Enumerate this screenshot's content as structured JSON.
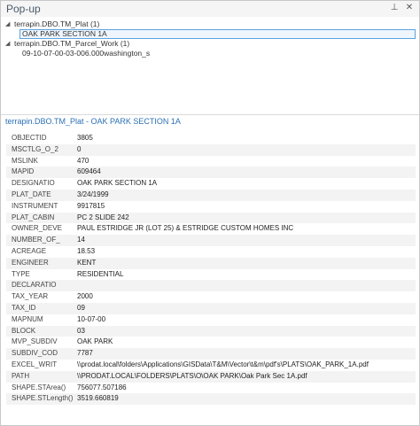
{
  "window": {
    "title": "Pop-up",
    "pin_glyph": "⊥",
    "close_glyph": "✕",
    "icons": {
      "pin": "pin-icon",
      "close": "close-icon",
      "expander": "triangle-down-icon"
    }
  },
  "tree": {
    "expander_glyph": "◢",
    "layers": [
      {
        "label": "terrapin.DBO.TM_Plat  (1)",
        "features": [
          "OAK PARK SECTION 1A"
        ]
      },
      {
        "label": "terrapin.DBO.TM_Parcel_Work  (1)",
        "features": [
          "09-10-07-00-03-006.000washington_s"
        ]
      }
    ]
  },
  "detail": {
    "title": "terrapin.DBO.TM_Plat - OAK PARK SECTION 1A",
    "fields": [
      {
        "name": "OBJECTID",
        "value": "3805"
      },
      {
        "name": "MSCTLG_O_2",
        "value": "0"
      },
      {
        "name": "MSLINK",
        "value": "470"
      },
      {
        "name": "MAPID",
        "value": "609464"
      },
      {
        "name": "DESIGNATIO",
        "value": "OAK PARK SECTION 1A"
      },
      {
        "name": "PLAT_DATE",
        "value": "3/24/1999"
      },
      {
        "name": "INSTRUMENT",
        "value": "9917815"
      },
      {
        "name": "PLAT_CABIN",
        "value": "PC 2 SLIDE 242"
      },
      {
        "name": "OWNER_DEVE",
        "value": "PAUL ESTRIDGE JR (LOT 25) & ESTRIDGE CUSTOM HOMES INC"
      },
      {
        "name": "NUMBER_OF_",
        "value": "14"
      },
      {
        "name": "ACREAGE",
        "value": "18.53"
      },
      {
        "name": "ENGINEER",
        "value": "KENT"
      },
      {
        "name": "TYPE",
        "value": "RESIDENTIAL"
      },
      {
        "name": "DECLARATIO",
        "value": ""
      },
      {
        "name": "TAX_YEAR",
        "value": "2000"
      },
      {
        "name": "TAX_ID",
        "value": "09"
      },
      {
        "name": "MAPNUM",
        "value": "10-07-00"
      },
      {
        "name": "BLOCK",
        "value": "03"
      },
      {
        "name": "MVP_SUBDIV",
        "value": "OAK PARK"
      },
      {
        "name": "SUBDIV_COD",
        "value": "7787"
      },
      {
        "name": "EXCEL_WRIT",
        "value": "\\\\prodat.local\\folders\\Applications\\GISData\\T&M\\Vector\\t&m\\pdf's\\PLATS\\OAK_PARK_1A.pdf"
      },
      {
        "name": "PATH",
        "value": "\\\\PRODAT.LOCAL\\FOLDERS\\PLATS\\O\\OAK PARK\\Oak Park Sec 1A.pdf"
      },
      {
        "name": "SHAPE.STArea()",
        "value": "756077.507186"
      },
      {
        "name": "SHAPE.STLength()",
        "value": "3519.660819"
      }
    ]
  }
}
